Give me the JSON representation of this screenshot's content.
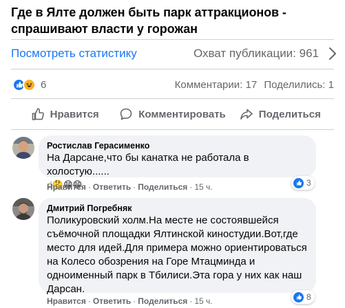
{
  "post": {
    "title": "Где в Ялте должен быть парк аттракционов - спрашивают власти у горожан"
  },
  "stats": {
    "view_link": "Посмотреть статистику",
    "reach_label": "Охват публикации: 961"
  },
  "reactions": {
    "count": "6",
    "comments": "Комментарии: 17",
    "shares": "Поделились: 1"
  },
  "actions": {
    "like": "Нравится",
    "comment": "Комментировать",
    "share": "Поделиться"
  },
  "comments": [
    {
      "author": "Ростислав Герасименко",
      "text": "На Дарсане,что бы канатка не работала в холостую......",
      "emoji": "☝🤔😁😁",
      "like": "Нравится",
      "reply": "Ответить",
      "share": "Поделиться",
      "time": "15 ч.",
      "likes": "3"
    },
    {
      "author": "Дмитрий Погребняк",
      "text_lines": [
        "Поликуровский холм.На месте не состоявшейся",
        "съёмочной площадки Ялтинской киностудии.Вот,где",
        "место для идей.Для примера можно ориентироваться",
        "на Колесо обозрения на Горе Мтацминда и",
        "одноименный парк в Тбилиси.Эта гора у них как наш",
        "Дарсан."
      ],
      "like": "Нравится",
      "reply": "Ответить",
      "share": "Поделиться",
      "time": "15 ч.",
      "likes": "8"
    }
  ],
  "colors": {
    "link": "#1877f2",
    "secondary_text": "#65676b",
    "bubble": "#f0f2f5",
    "divider": "#ced0d4"
  }
}
